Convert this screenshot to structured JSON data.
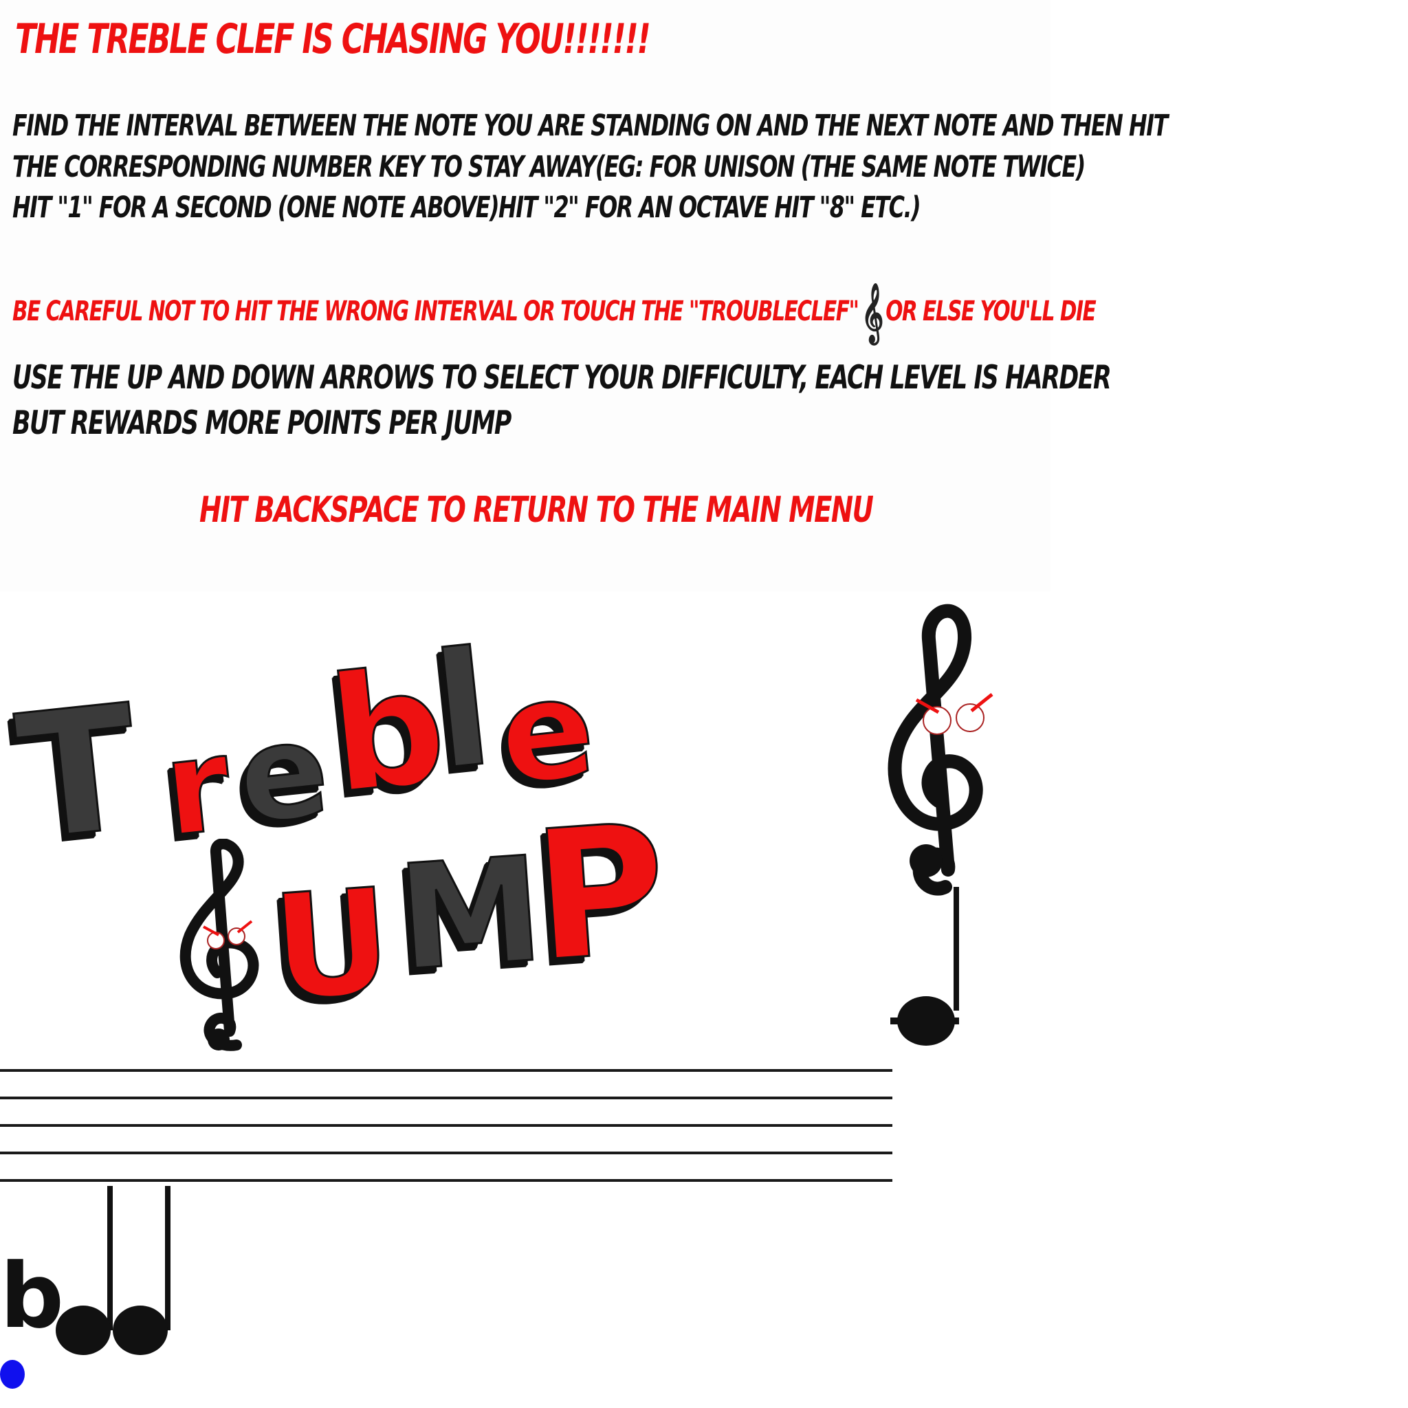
{
  "instructions": {
    "title": "The treble clef is chasing you!!!!!!!",
    "paragraph_lines": [
      "Find the interval between the note you are standing on and the next note and then hit",
      "the corresponding number key to stay away(eg: for unison (the same note twice)",
      "hit \"1\" for a second (one note above)hit \"2\" for an octave hit \"8\" etc.)"
    ],
    "warning_before": "Be careful not to hit the wrong interval or touch the \"troubleclef\"",
    "warning_icon": "𝄞",
    "warning_after": "or else you'll die",
    "difficulty_lines": [
      "Use the up and down arrows to select your difficulty, each level is harder",
      "but rewards more points per jump"
    ],
    "back_hint": "Hit backspace to return to the main menu"
  },
  "logo": {
    "letters_line1": [
      "T",
      "r",
      "e",
      "b",
      "l",
      "e"
    ],
    "letters_line2": [
      "U",
      "M",
      "P"
    ],
    "colors": {
      "dark": "#3a3a3a",
      "red": "#ee1111",
      "outline": "#111111"
    }
  },
  "game": {
    "player_color": "#1010ee",
    "enemy": "troubleclef",
    "note_flat_symbol": "b"
  }
}
